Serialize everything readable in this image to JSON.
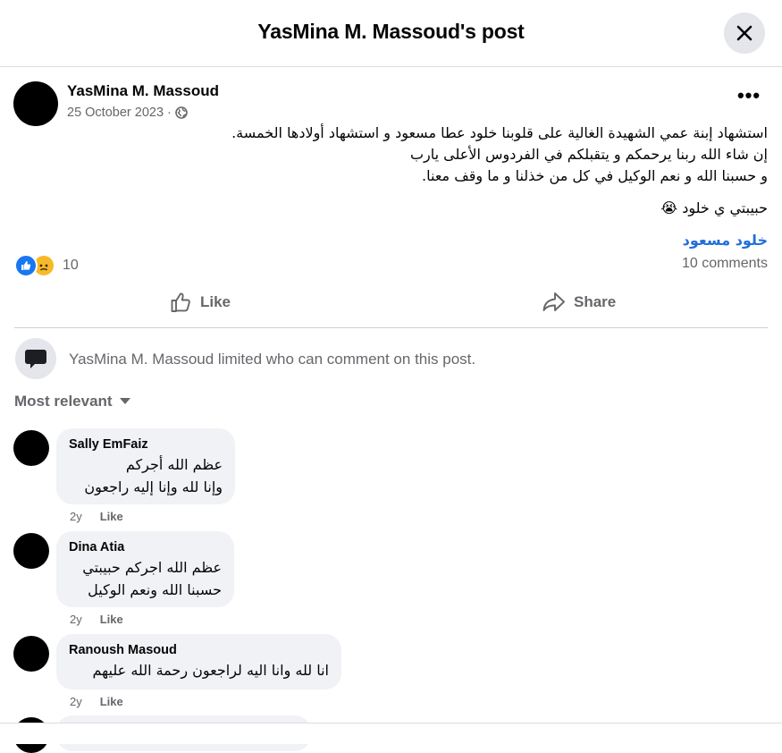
{
  "header": {
    "title": "YasMina M. Massoud's post"
  },
  "post": {
    "author": "YasMina M. Massoud",
    "date": "25 October 2023",
    "date_separator": "·",
    "lines": [
      "استشهاد إبنة عمي الشهيدة الغالية على قلوبنا خلود عطا مسعود و استشهاد أولادها الخمسة.",
      "إن شاء الله ربنا يرحمكم و يتقبلكم في الفردوس الأعلى يارب",
      "و حسبنا الله و نعم الوكيل في كل من خذلنا و ما وقف معنا."
    ],
    "line2": "حبيبتي ي خلود 😭",
    "mention": "خلود مسعود",
    "reaction_count": "10",
    "comments_count": "10 comments"
  },
  "actions": {
    "like_label": "Like",
    "share_label": "Share"
  },
  "comment_notice": "YasMina M. Massoud limited who can comment on this post.",
  "sort_label": "Most relevant",
  "comments": [
    {
      "name": "Sally EmFaiz",
      "lines": [
        "عظم الله أجركم",
        "وإنا لله وإنا إليه راجعون"
      ],
      "time": "2y",
      "like": "Like"
    },
    {
      "name": "Dina Atia",
      "lines": [
        "عظم الله اجركم حبيبتي",
        "حسبنا الله ونعم الوكيل"
      ],
      "time": "2y",
      "like": "Like"
    },
    {
      "name": "Ranoush Masoud",
      "lines": [
        "انا لله وانا اليه لراجعون رحمة الله عليهم"
      ],
      "time": "2y",
      "like": "Like"
    }
  ],
  "colors": {
    "link": "#216fdb",
    "like_blue": "#1877f2",
    "sad_yellow": "#f7b928",
    "muted": "#65676b",
    "bubble": "#f0f2f5"
  }
}
